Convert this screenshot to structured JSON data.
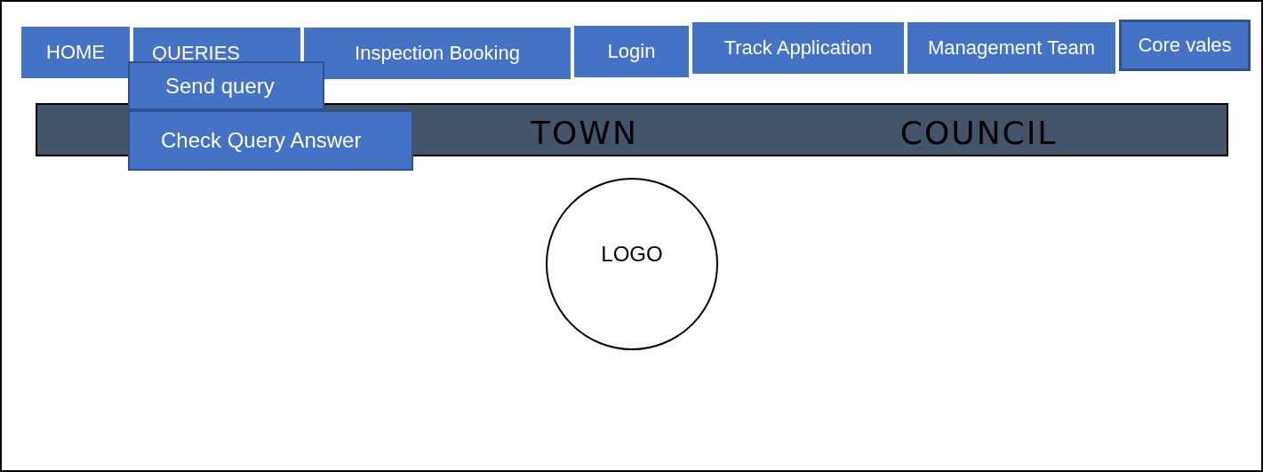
{
  "nav": [
    {
      "label": "HOME",
      "selected": false,
      "expanded": false
    },
    {
      "label": "QUERIES",
      "selected": false,
      "expanded": true,
      "menu": [
        {
          "label": "Send query"
        },
        {
          "label": "Check Query Answer"
        }
      ]
    },
    {
      "label": "Inspection Booking",
      "selected": false,
      "expanded": false
    },
    {
      "label": "Login",
      "selected": false,
      "expanded": false
    },
    {
      "label": "Track Application",
      "selected": false,
      "expanded": false
    },
    {
      "label": "Management Team",
      "selected": false,
      "expanded": false
    },
    {
      "label": "Core vales",
      "selected": true,
      "expanded": false
    }
  ],
  "banner": {
    "words": [
      "TOWN",
      "COUNCIL"
    ]
  },
  "logo": {
    "label": "LOGO"
  }
}
